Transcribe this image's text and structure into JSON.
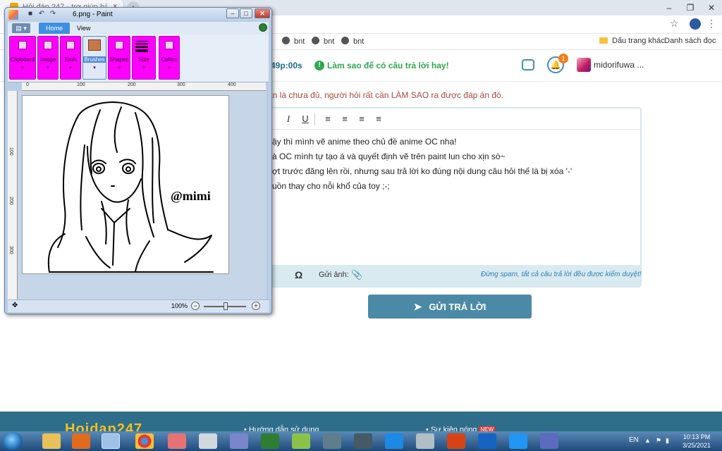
{
  "browser": {
    "tab_title": "Hỏi đáp 247 - trợ giúp bài...",
    "tab_close": "×",
    "new_tab": "+",
    "window_buttons": [
      "–",
      "❐",
      "✕"
    ],
    "star": "☆",
    "menu": "⋮",
    "bookmarks": [
      "bnt",
      "bnt",
      "bnt"
    ],
    "bookmarks_right": [
      "Dấu trang khác",
      "Danh sách đọc"
    ]
  },
  "header": {
    "timer": "49p:00s",
    "tip_icon": "!",
    "tip": "Làm sao để có câu trả lời hay!",
    "notifications_count": "1",
    "username": "midorifuwa ..."
  },
  "warning": "ần là chưa đủ, người hỏi rất cần LÀM SAO ra được đáp án đó.",
  "editor": {
    "toolbar": [
      "I",
      "U",
      "≡",
      "≡",
      "≡",
      "≡"
    ],
    "lines": [
      "ậy thì mình vẽ anime theo chủ đề anime OC nha!",
      "à OC mình tự tạo á và quyết định vẽ trên paint lun cho xịn sò~",
      "ợt trước đăng lên rồi, nhưng sau trả lời ko đúng nội dung câu hỏi thế là bị xóa '-'",
      "uồn thay cho nỗi khổ của toy ;-;"
    ],
    "footer_omega": "Ω",
    "footer_upload": "Gửi ảnh:",
    "footer_note": "Đừng spam, tất cả câu trả lời đều được kiểm duyệt!"
  },
  "submit_label": "GỬI TRẢ LỜI",
  "footer": {
    "logo": "Hoidap247",
    "links": [
      "Hướng dẫn sử dụng",
      "Sự kiện nóng"
    ],
    "new_badge": "NEW"
  },
  "paint": {
    "title": "6.png - Paint",
    "menu_label": "▤ ▾",
    "tabs": [
      "Home",
      "View"
    ],
    "groups": [
      "Clipboard",
      "Image",
      "Tools",
      "Brushes",
      "Shapes",
      "Size",
      "Colors"
    ],
    "group_arrow": "▾",
    "ruler_top": [
      "0",
      "100",
      "200",
      "300",
      "400"
    ],
    "ruler_left": [
      "100",
      "200",
      "300"
    ],
    "signature": "@mimi",
    "zoom": "100%",
    "zoom_minus": "−",
    "zoom_plus": "+",
    "window_buttons": [
      "–",
      "□",
      "✕"
    ]
  },
  "taskbar": {
    "lang": "EN",
    "time": "10:13 PM",
    "date": "3/25/2021"
  },
  "colors": {
    "accent": "#4b8aa6",
    "ribbon_highlight": "#ff00ff",
    "tip_green": "#2fa84f",
    "warning_red": "#a64b3a"
  }
}
